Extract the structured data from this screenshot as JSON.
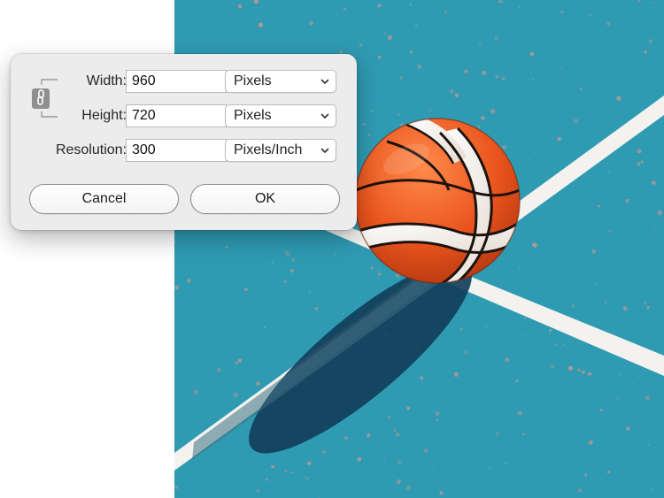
{
  "dialog": {
    "width": {
      "label": "Width:",
      "value": "960",
      "unit": "Pixels"
    },
    "height": {
      "label": "Height:",
      "value": "720",
      "unit": "Pixels"
    },
    "resolution": {
      "label": "Resolution:",
      "value": "300",
      "unit": "Pixels/Inch"
    },
    "constrain_icon": "chain-link-icon",
    "cancel_label": "Cancel",
    "ok_label": "OK"
  },
  "colors": {
    "court": "#2f9bb3",
    "court_speckle": "#c9968c",
    "ball": "#e9541d",
    "shadow": "#123f5b",
    "court_line": "#f3f2ee"
  }
}
